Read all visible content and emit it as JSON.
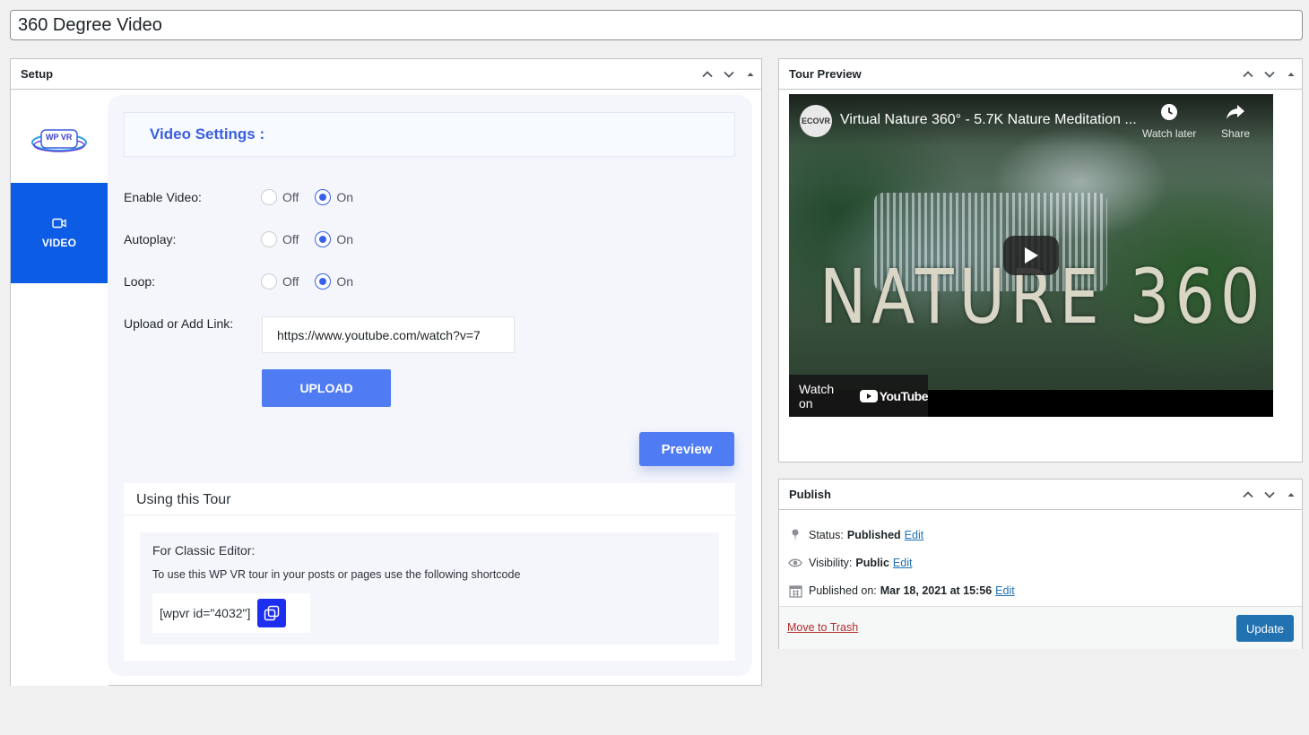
{
  "post_title": "360 Degree Video",
  "setup": {
    "title": "Setup",
    "logo_text": "WP VR",
    "tab": {
      "label": "VIDEO"
    },
    "video_settings_heading": "Video Settings :",
    "rows": {
      "enable_video": {
        "label": "Enable Video:",
        "off": "Off",
        "on": "On",
        "selected": "On"
      },
      "autoplay": {
        "label": "Autoplay:",
        "off": "Off",
        "on": "On",
        "selected": "On"
      },
      "loop": {
        "label": "Loop:",
        "off": "Off",
        "on": "On",
        "selected": "On"
      }
    },
    "upload_label": "Upload or Add Link:",
    "upload_value": "https://www.youtube.com/watch?v=7",
    "upload_button": "UPLOAD",
    "preview_button": "Preview",
    "using_tour": {
      "title": "Using this Tour",
      "classic_title": "For Classic Editor:",
      "classic_desc": "To use this WP VR tour in your posts or pages use the following shortcode",
      "shortcode": "[wpvr id=\"4032\"]"
    }
  },
  "tour_preview": {
    "title": "Tour Preview",
    "video": {
      "channel_badge": "ECOVR",
      "title": "Virtual Nature 360° - 5.7K Nature Meditation ...",
      "watch_later": "Watch later",
      "share": "Share",
      "overlay_text": "NATURE 360",
      "watch_on": "Watch on",
      "youtube": "YouTube"
    }
  },
  "publish": {
    "title": "Publish",
    "status_label": "Status:",
    "status_value": "Published",
    "visibility_label": "Visibility:",
    "visibility_value": "Public",
    "published_label": "Published on:",
    "published_value": "Mar 18, 2021 at 15:56",
    "edit": "Edit",
    "trash": "Move to Trash",
    "update": "Update"
  },
  "colors": {
    "wp_blue": "#2271b1",
    "side_tab": "#0d5ce6",
    "accent": "#4f7bf3",
    "trash": "#b32d2e"
  }
}
